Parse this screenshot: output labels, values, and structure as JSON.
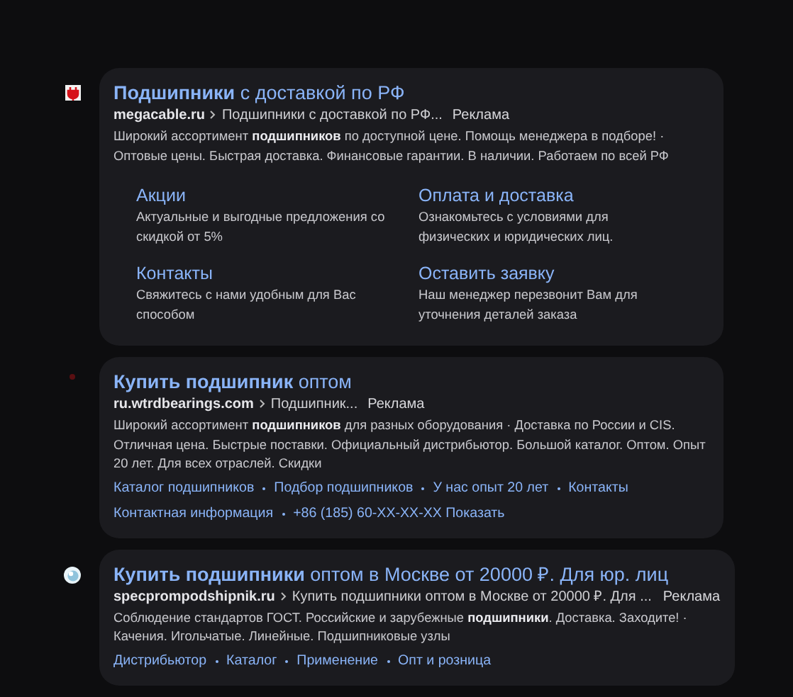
{
  "ads": [
    {
      "kind": "plug",
      "title": "**Подшипники** с доставкой по РФ",
      "domain": "megacable.ru",
      "path": "Подшипники с доставкой по РФ...",
      "label": "Реклама",
      "description": "Широкий ассортимент **подшипников** по доступной цене. Помощь менеджера в подборе! · Оптовые цены. Быстрая доставка. Финансовые гарантии. В наличии. Работаем по всей РФ",
      "sitelink_blocks": [
        {
          "title": "Акции",
          "text": "Актуальные и выгодные предложения со скидкой от 5%"
        },
        {
          "title": "Оплата и доставка",
          "text": "Ознакомьтесь с условиями для физических и юридических лиц."
        },
        {
          "title": "Контакты",
          "text": "Свяжитесь с нами удобным для Вас способом"
        },
        {
          "title": "Оставить заявку",
          "text": "Наш менеджер перезвонит Вам для уточнения деталей заказа"
        }
      ]
    },
    {
      "kind": "dot",
      "title": "**Купить подшипник** оптом",
      "domain": "ru.wtrdbearings.com",
      "path": "Подшипник...",
      "label": "Реклама",
      "description": "Широкий ассортимент **подшипников** для разных оборудования · Доставка по России и CIS. Отличная цена. Быстрые поставки. Официальный дистрибьютор. Большой каталог. Оптом. Опыт 20 лет. Для всех отраслей. Скидки",
      "link_rows": [
        [
          "Каталог подшипников",
          "Подбор подшипников",
          "У нас опыт 20 лет",
          "Контакты"
        ],
        [
          "Контактная информация",
          "+86 (185) 60-XX-XX-XX Показать"
        ]
      ]
    },
    {
      "kind": "globe",
      "title": "**Купить подшипники** оптом в Москве от 20000 ₽. Для юр. лиц",
      "domain": "specprompodshipnik.ru",
      "path": "Купить подшипники оптом в Москве от 20000 ₽. Для ...",
      "label": "Реклама",
      "description": "Соблюдение стандартов ГОСТ. Российские и зарубежные **подшипники**. Доставка. Заходите! · Качения. Игольчатые. Линейные. Подшипниковые узлы",
      "link_rows": [
        [
          "Дистрибьютор",
          "Каталог",
          "Применение",
          "Опт и розница"
        ]
      ]
    }
  ]
}
